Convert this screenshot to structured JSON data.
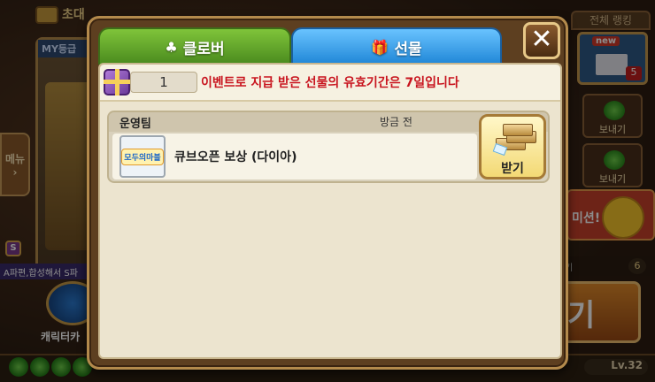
{
  "background": {
    "top_left_label": "초대",
    "card_header": "MY등급",
    "menu_label": "메뉴",
    "ticker": "A파편,합성해서 S파",
    "s_badge": "S",
    "character_label": "캐릭터카",
    "ranking_tab": "전체 랭킹",
    "mail_new": "new",
    "mail_count": "5",
    "send_label_1": "보내기",
    "send_label_2": "보내기",
    "mission_text": "미션!",
    "key_label": "기",
    "key_count": "6",
    "big_button_text": "기",
    "level": "Lv.32"
  },
  "tabs": [
    {
      "label": "클로버",
      "icon": "clover-icon"
    },
    {
      "label": "선물",
      "icon": "gift-icon"
    }
  ],
  "close_label": "✕",
  "notice": {
    "gift_count": "1",
    "text": "이벤트로 지급 받은 선물의 유효기간은 7일입니다"
  },
  "gift_items": [
    {
      "sender": "운영팀",
      "time": "방금 전",
      "logo_text": "모두의마블",
      "title": "큐브오픈 보상 (다이아)",
      "button_label": "받기"
    }
  ],
  "colors": {
    "clover_tab": "#5fa82a",
    "gift_tab": "#2f97e6",
    "notice_text": "#c8141e",
    "modal_frame": "#5d3f20"
  }
}
